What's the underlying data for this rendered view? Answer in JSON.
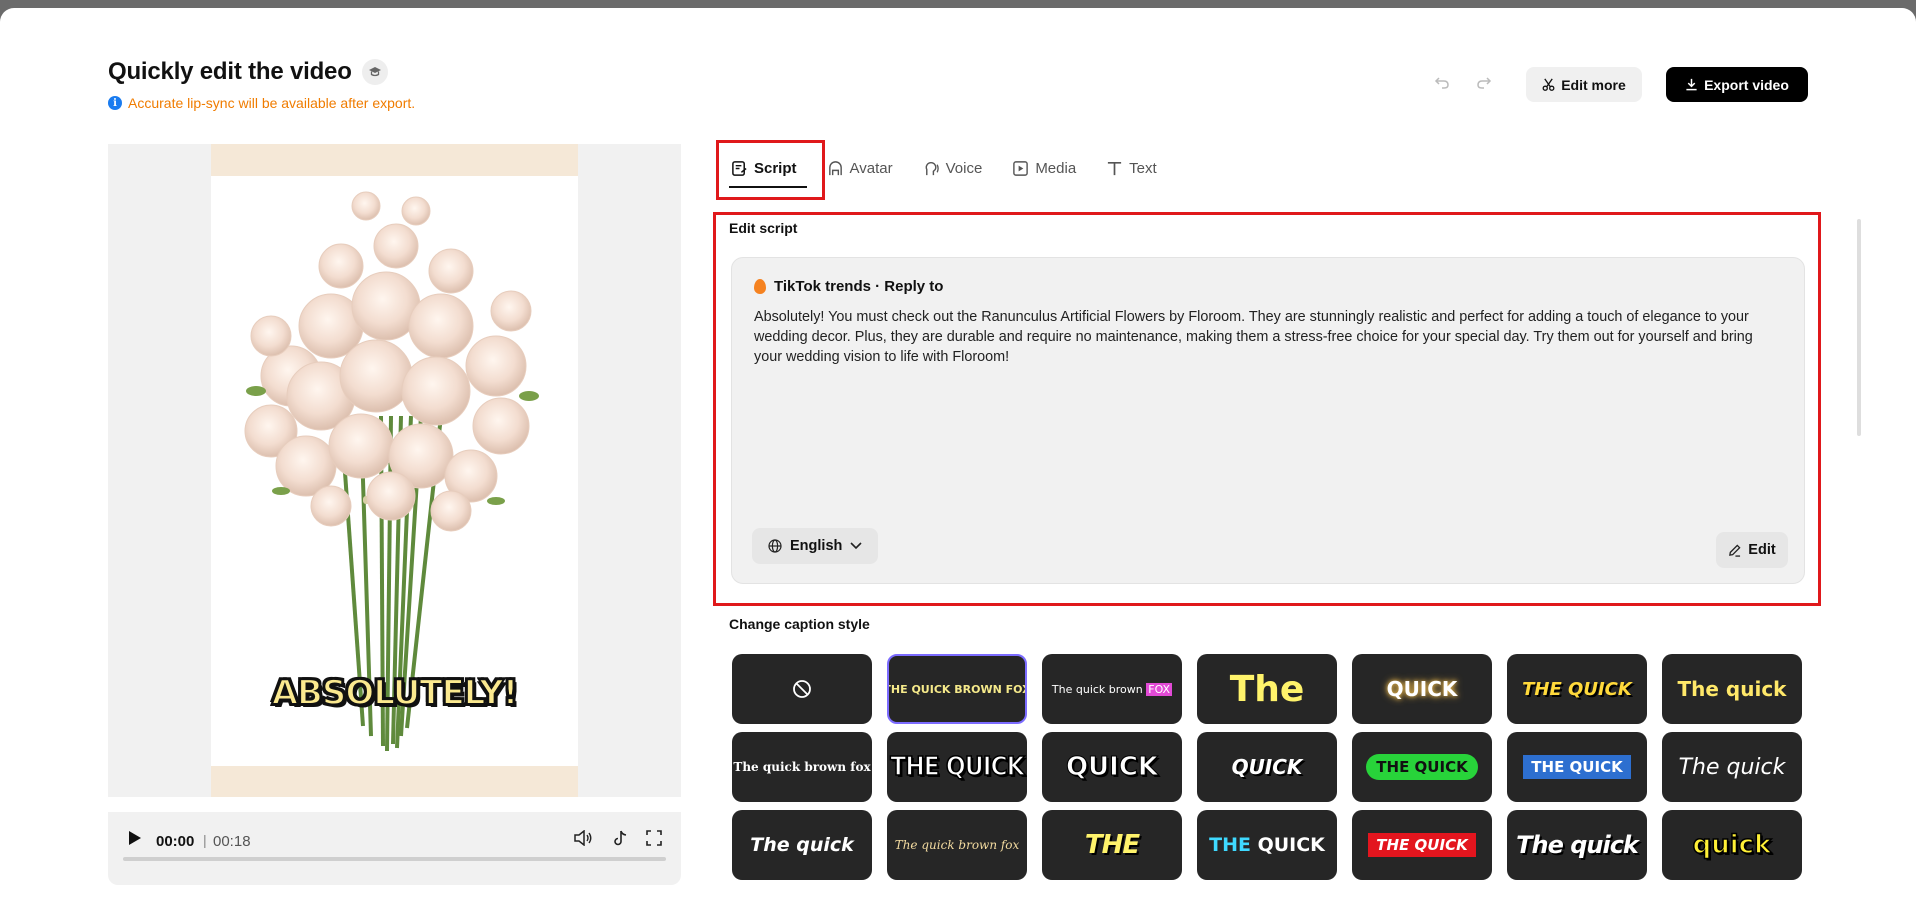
{
  "page": {
    "title": "Quickly edit the video",
    "notice": "Accurate lip-sync will be available after export."
  },
  "toolbar": {
    "edit_more": "Edit more",
    "export": "Export video"
  },
  "player": {
    "current_time": "00:00",
    "duration": "00:18",
    "progress": 0.0
  },
  "preview": {
    "caption": "ABSOLUTELY!"
  },
  "tabs": [
    {
      "label": "Script",
      "icon": "script-icon",
      "active": true
    },
    {
      "label": "Avatar",
      "icon": "avatar-icon",
      "active": false
    },
    {
      "label": "Voice",
      "icon": "voice-icon",
      "active": false
    },
    {
      "label": "Media",
      "icon": "media-icon",
      "active": false
    },
    {
      "label": "Text",
      "icon": "text-icon",
      "active": false
    }
  ],
  "script": {
    "section_title": "Edit script",
    "trend_label": "TikTok trends · Reply to",
    "text": "Absolutely! You must check out the Ranunculus Artificial Flowers by Floroom. They are stunningly realistic and perfect for adding a touch of elegance to your wedding decor. Plus, they are durable and require no maintenance, making them a stress-free choice for your special day. Try them out for yourself and bring your wedding vision to life with Floroom!",
    "language": "English",
    "edit_label": "Edit"
  },
  "captions": {
    "section_title": "Change caption style",
    "selected_index": 1,
    "styles": [
      {
        "text": ""
      },
      {
        "text": "THE QUICK BROWN  FOX"
      },
      {
        "text": "The quick brown FOX"
      },
      {
        "text": "The"
      },
      {
        "text": "QUICK"
      },
      {
        "text": "THE QUICK"
      },
      {
        "text": "The quick"
      },
      {
        "text": "The quick brown fox"
      },
      {
        "text": "THE QUICK"
      },
      {
        "text": "QUICK"
      },
      {
        "text": "QUICK"
      },
      {
        "text": "THE QUICK"
      },
      {
        "text": "THE QUICK"
      },
      {
        "text": "The quick"
      },
      {
        "text": "The quick"
      },
      {
        "text": "The quick brown fox"
      },
      {
        "text": "THE"
      },
      {
        "text": "THE QUICK"
      },
      {
        "text": "THE QUICK"
      },
      {
        "text": "The quick"
      },
      {
        "text": "quick"
      }
    ]
  },
  "colors": {
    "accent_red": "#e0181b",
    "notice_orange": "#f07c00",
    "info_blue": "#1a7cf0",
    "tile_bg": "#262626",
    "selected_border": "#7c6cff"
  }
}
